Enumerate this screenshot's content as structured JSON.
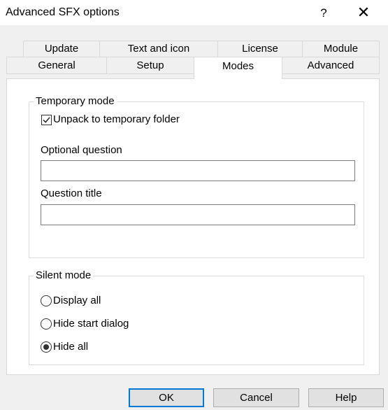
{
  "window": {
    "title": "Advanced SFX options",
    "help_label": "?",
    "close_label": "✕"
  },
  "tabs": {
    "row1": [
      "Update",
      "Text and icon",
      "License",
      "Module"
    ],
    "row2": [
      "General",
      "Setup",
      "Modes",
      "Advanced"
    ],
    "active": "Modes"
  },
  "temporary_mode": {
    "group_label": "Temporary mode",
    "unpack_label": "Unpack to temporary folder",
    "unpack_checked": true,
    "optional_question_label": "Optional question",
    "optional_question_value": "",
    "question_title_label": "Question title",
    "question_title_value": ""
  },
  "silent_mode": {
    "group_label": "Silent mode",
    "options": [
      "Display all",
      "Hide start dialog",
      "Hide all"
    ],
    "selected": "Hide all"
  },
  "buttons": {
    "ok": "OK",
    "cancel": "Cancel",
    "help": "Help"
  }
}
